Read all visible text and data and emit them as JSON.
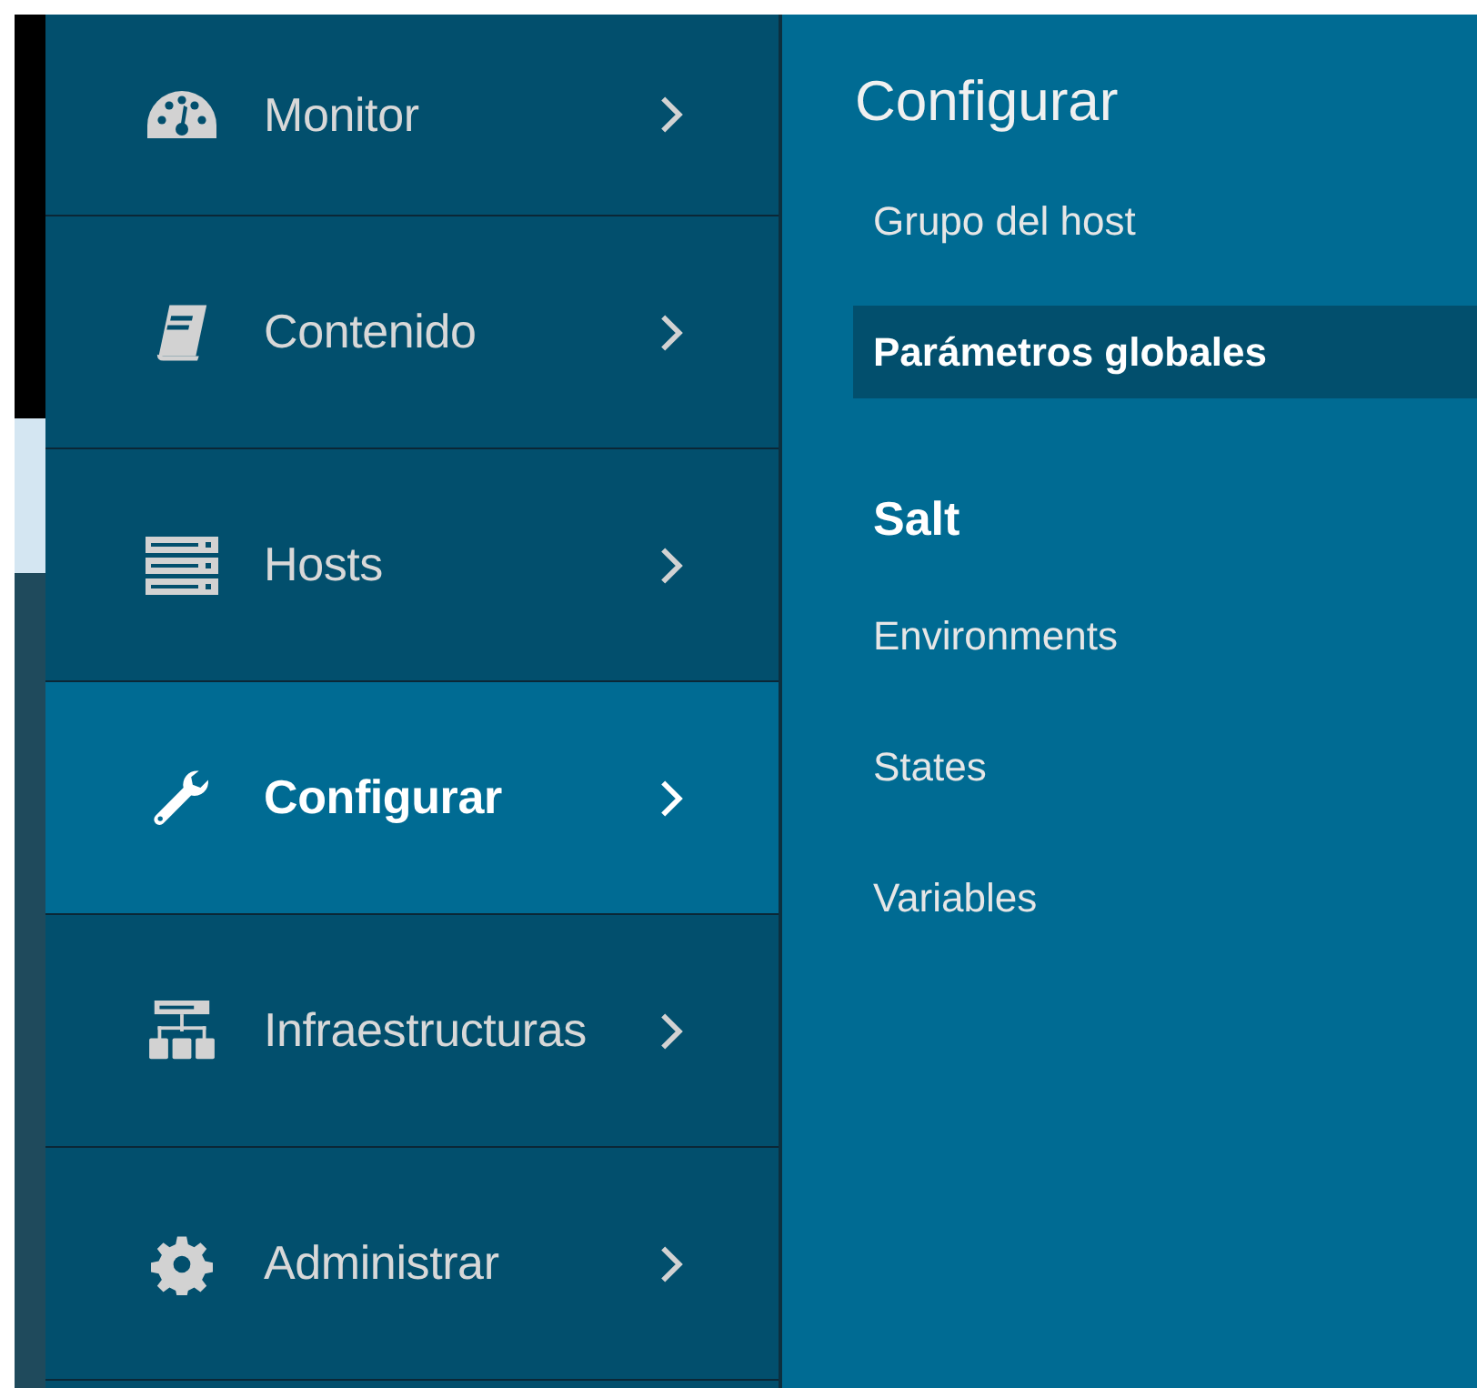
{
  "sidebar": {
    "items": [
      {
        "label": "Monitor",
        "selected": false
      },
      {
        "label": "Contenido",
        "selected": false
      },
      {
        "label": "Hosts",
        "selected": false
      },
      {
        "label": "Configurar",
        "selected": true
      },
      {
        "label": "Infraestructuras",
        "selected": false
      },
      {
        "label": "Administrar",
        "selected": false
      }
    ]
  },
  "flyout": {
    "title": "Configurar",
    "sections": [
      {
        "items": [
          {
            "label": "Grupo del host",
            "selected": false
          },
          {
            "label": "Parámetros globales",
            "selected": true
          }
        ]
      },
      {
        "heading": "Salt",
        "items": [
          {
            "label": "Environments",
            "selected": false
          },
          {
            "label": "States",
            "selected": false
          },
          {
            "label": "Variables",
            "selected": false
          }
        ]
      }
    ]
  }
}
